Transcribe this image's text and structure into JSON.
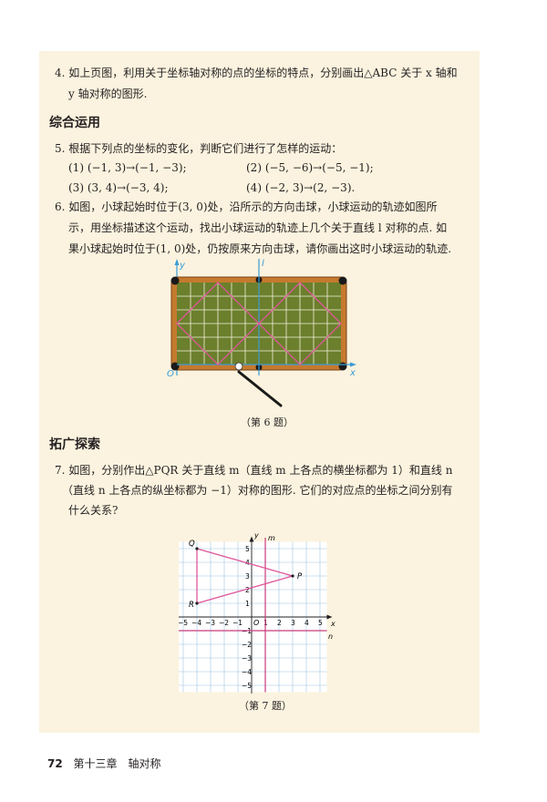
{
  "exercise4": {
    "line1": "4. 如上页图，利用关于坐标轴对称的点的坐标的特点，分别画出△ABC 关于 x 轴和",
    "line2": "y 轴对称的图形."
  },
  "section_comprehensive": "综合运用",
  "exercise5": {
    "intro": "5. 根据下列点的坐标的变化，判断它们进行了怎样的运动：",
    "items": [
      "(1) (−1, 3)→(−1, −3);",
      "(2) (−5, −6)→(−5, −1);",
      "(3) (3, 4)→(−3, 4);",
      "(4) (−2, 3)→(2, −3)."
    ]
  },
  "exercise6": {
    "lines": [
      "6. 如图，小球起始时位于(3, 0)处，沿所示的方向击球，小球运动的轨迹如图所",
      "示，用坐标描述这个运动，找出小球运动的轨迹上几个关于直线 l 对称的点. 如",
      "果小球起始时位于(1, 0)处，仍按原来方向击球，请你画出这时小球运动的轨迹."
    ],
    "caption": "（第 6 题）",
    "axis_labels": {
      "y": "y",
      "x": "x",
      "origin": "O",
      "line": "l"
    }
  },
  "section_extension": "拓广探索",
  "exercise7": {
    "lines": [
      "7. 如图，分别作出△PQR 关于直线 m（直线 m 上各点的横坐标都为 1）和直线 n",
      "（直线 n 上各点的纵坐标都为 −1）对称的图形. 它们的对应点的坐标之间分别有",
      "什么关系?"
    ],
    "caption": "（第 7 题）",
    "graph": {
      "points": {
        "P": [
          3,
          3
        ],
        "Q": [
          -4,
          5
        ],
        "R": [
          -4,
          1
        ]
      },
      "line_m_x": 1,
      "line_n_y": -1,
      "x_ticks": [
        "−5",
        "−4",
        "−3",
        "−2",
        "−1",
        "1",
        "2",
        "3",
        "4",
        "5"
      ],
      "y_ticks_pos": [
        "5",
        "4",
        "3",
        "2",
        "1"
      ],
      "y_ticks_neg": [
        "−1",
        "−2",
        "−3",
        "−4",
        "−5"
      ],
      "labels": {
        "x": "x",
        "y": "y",
        "origin": "O",
        "m": "m",
        "n": "n"
      },
      "colors": {
        "triangle": "#e0569a",
        "lines": "#c83c7c",
        "grid": "#9fc4e0"
      }
    }
  },
  "footer": {
    "page": "72",
    "chapter": "第十三章　轴对称"
  }
}
